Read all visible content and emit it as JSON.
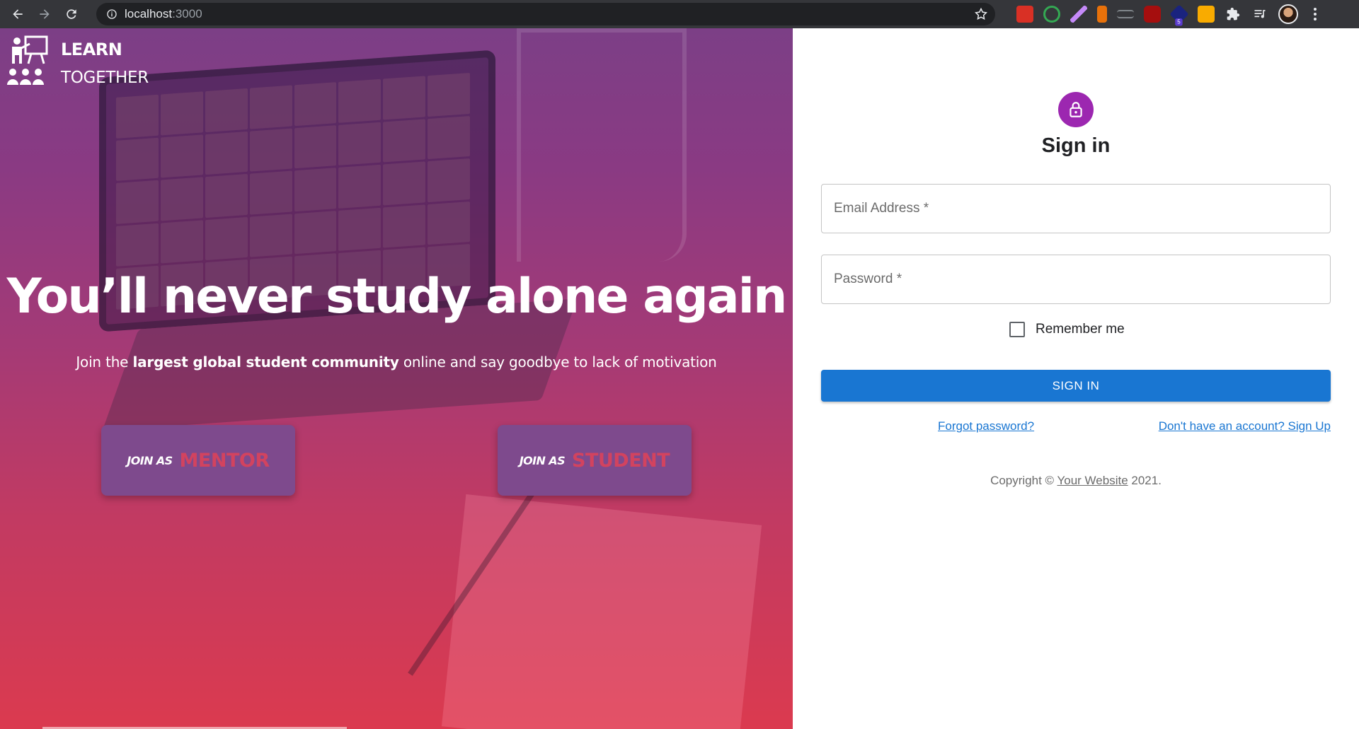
{
  "browser": {
    "url_host": "localhost",
    "url_port": ":3000",
    "extension_badge": "5"
  },
  "brand": {
    "line1": "LEARN",
    "line2": "TOGETHER"
  },
  "hero": {
    "headline": "You’ll never study alone again",
    "sub_before": "Join the ",
    "sub_bold": "largest global student community",
    "sub_after": " online and say goodbye to lack of motivation",
    "join_prefix": "JOIN AS",
    "mentor_label": "MENTOR",
    "student_label": "STUDENT"
  },
  "signin": {
    "title": "Sign in",
    "email_placeholder": "Email Address *",
    "password_placeholder": "Password *",
    "remember_label": "Remember me",
    "button_label": "SIGN IN",
    "forgot_link": "Forgot password?",
    "signup_link": "Don't have an account? Sign Up",
    "copyright_prefix": "Copyright © ",
    "copyright_site": "Your Website",
    "copyright_suffix": " 2021."
  },
  "colors": {
    "avatar_bg": "#9c27b0",
    "primary": "#1976d2",
    "join_button_bg": "#7e4a8d",
    "join_role_text": "#d2435f"
  },
  "icons": {
    "back": "arrow-left-icon",
    "forward": "arrow-right-icon",
    "reload": "reload-icon",
    "site_info": "info-icon",
    "bookmark": "star-icon",
    "avatar": "lock-icon",
    "logo": "teacher-board-icon",
    "menu": "three-dots-icon"
  }
}
